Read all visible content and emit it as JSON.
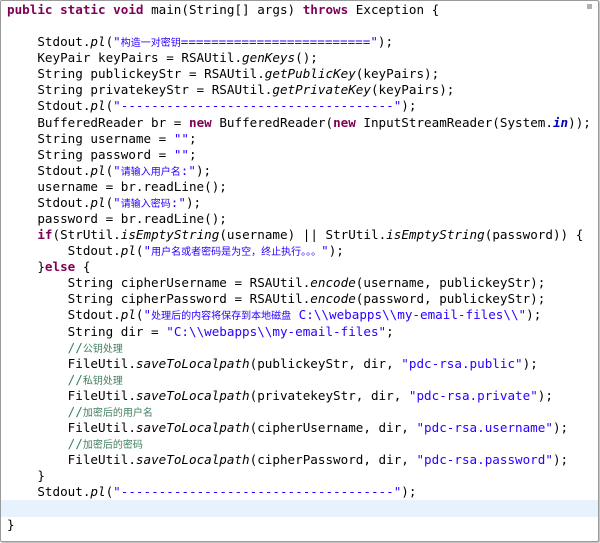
{
  "code": {
    "lines": [
      [
        {
          "t": "public static void ",
          "c": "kw"
        },
        {
          "t": "main(String[] args) "
        },
        {
          "t": "throws",
          "c": "kw"
        },
        {
          "t": " Exception {"
        }
      ],
      [],
      [
        {
          "t": "    Stdout."
        },
        {
          "t": "pl",
          "c": "it"
        },
        {
          "t": "("
        },
        {
          "t": "\"构造一对密钥=========================\"",
          "c": "str"
        },
        {
          "t": ");"
        }
      ],
      [
        {
          "t": "    KeyPair keyPairs = RSAUtil."
        },
        {
          "t": "genKeys",
          "c": "it"
        },
        {
          "t": "();"
        }
      ],
      [
        {
          "t": "    String publickeyStr = RSAUtil."
        },
        {
          "t": "getPublicKey",
          "c": "it"
        },
        {
          "t": "(keyPairs);"
        }
      ],
      [
        {
          "t": "    String privatekeyStr = RSAUtil."
        },
        {
          "t": "getPrivateKey",
          "c": "it"
        },
        {
          "t": "(keyPairs);"
        }
      ],
      [
        {
          "t": "    Stdout."
        },
        {
          "t": "pl",
          "c": "it"
        },
        {
          "t": "("
        },
        {
          "t": "\"------------------------------------\"",
          "c": "str"
        },
        {
          "t": ");"
        }
      ],
      [
        {
          "t": "    BufferedReader br = "
        },
        {
          "t": "new",
          "c": "kw"
        },
        {
          "t": " BufferedReader("
        },
        {
          "t": "new",
          "c": "kw"
        },
        {
          "t": " InputStreamReader(System."
        },
        {
          "t": "in",
          "c": "fld"
        },
        {
          "t": "));"
        }
      ],
      [
        {
          "t": "    String username = "
        },
        {
          "t": "\"\"",
          "c": "str"
        },
        {
          "t": ";"
        }
      ],
      [
        {
          "t": "    String password = "
        },
        {
          "t": "\"\"",
          "c": "str"
        },
        {
          "t": ";"
        }
      ],
      [
        {
          "t": "    Stdout."
        },
        {
          "t": "pl",
          "c": "it"
        },
        {
          "t": "("
        },
        {
          "t": "\"请输入用户名:\"",
          "c": "str"
        },
        {
          "t": ");"
        }
      ],
      [
        {
          "t": "    username = br.readLine();"
        }
      ],
      [
        {
          "t": "    Stdout."
        },
        {
          "t": "pl",
          "c": "it"
        },
        {
          "t": "("
        },
        {
          "t": "\"请输入密码:\"",
          "c": "str"
        },
        {
          "t": ");"
        }
      ],
      [
        {
          "t": "    password = br.readLine();"
        }
      ],
      [
        {
          "t": "    "
        },
        {
          "t": "if",
          "c": "kw"
        },
        {
          "t": "(StrUtil."
        },
        {
          "t": "isEmptyString",
          "c": "it"
        },
        {
          "t": "(username) || StrUtil."
        },
        {
          "t": "isEmptyString",
          "c": "it"
        },
        {
          "t": "(password)) {"
        }
      ],
      [
        {
          "t": "        Stdout."
        },
        {
          "t": "pl",
          "c": "it"
        },
        {
          "t": "("
        },
        {
          "t": "\"用户名或者密码是为空，终止执行。。。\"",
          "c": "str"
        },
        {
          "t": ");"
        }
      ],
      [
        {
          "t": "    }"
        },
        {
          "t": "else",
          "c": "kw"
        },
        {
          "t": " {"
        }
      ],
      [
        {
          "t": "        String cipherUsername = RSAUtil."
        },
        {
          "t": "encode",
          "c": "it"
        },
        {
          "t": "(username, publickeyStr);"
        }
      ],
      [
        {
          "t": "        String cipherPassword = RSAUtil."
        },
        {
          "t": "encode",
          "c": "it"
        },
        {
          "t": "(password, publickeyStr);"
        }
      ],
      [
        {
          "t": "        Stdout."
        },
        {
          "t": "pl",
          "c": "it"
        },
        {
          "t": "("
        },
        {
          "t": "\"处理后的内容将保存到本地磁盘 C:\\\\webapps\\\\my-email-files\\\\\"",
          "c": "str"
        },
        {
          "t": ");"
        }
      ],
      [
        {
          "t": "        String dir = "
        },
        {
          "t": "\"C:\\\\webapps\\\\my-email-files\"",
          "c": "str"
        },
        {
          "t": ";"
        }
      ],
      [
        {
          "t": "        "
        },
        {
          "t": "//公钥处理",
          "c": "cmt"
        }
      ],
      [
        {
          "t": "        FileUtil."
        },
        {
          "t": "saveToLocalpath",
          "c": "it"
        },
        {
          "t": "(publickeyStr, dir, "
        },
        {
          "t": "\"pdc-rsa.public\"",
          "c": "str"
        },
        {
          "t": ");"
        }
      ],
      [
        {
          "t": "        "
        },
        {
          "t": "//私钥处理",
          "c": "cmt"
        }
      ],
      [
        {
          "t": "        FileUtil."
        },
        {
          "t": "saveToLocalpath",
          "c": "it"
        },
        {
          "t": "(privatekeyStr, dir, "
        },
        {
          "t": "\"pdc-rsa.private\"",
          "c": "str"
        },
        {
          "t": ");"
        }
      ],
      [
        {
          "t": "        "
        },
        {
          "t": "//加密后的用户名",
          "c": "cmt"
        }
      ],
      [
        {
          "t": "        FileUtil."
        },
        {
          "t": "saveToLocalpath",
          "c": "it"
        },
        {
          "t": "(cipherUsername, dir, "
        },
        {
          "t": "\"pdc-rsa.username\"",
          "c": "str"
        },
        {
          "t": ");"
        }
      ],
      [
        {
          "t": "        "
        },
        {
          "t": "//加密后的密码",
          "c": "cmt"
        }
      ],
      [
        {
          "t": "        FileUtil."
        },
        {
          "t": "saveToLocalpath",
          "c": "it"
        },
        {
          "t": "(cipherPassword, dir, "
        },
        {
          "t": "\"pdc-rsa.password\"",
          "c": "str"
        },
        {
          "t": ");"
        }
      ],
      [
        {
          "t": "    }"
        }
      ],
      [
        {
          "t": "    Stdout."
        },
        {
          "t": "pl",
          "c": "it"
        },
        {
          "t": "("
        },
        {
          "t": "\"------------------------------------\"",
          "c": "str"
        },
        {
          "t": ");"
        }
      ],
      [],
      [
        {
          "t": "}"
        }
      ]
    ],
    "current_line": 31
  }
}
